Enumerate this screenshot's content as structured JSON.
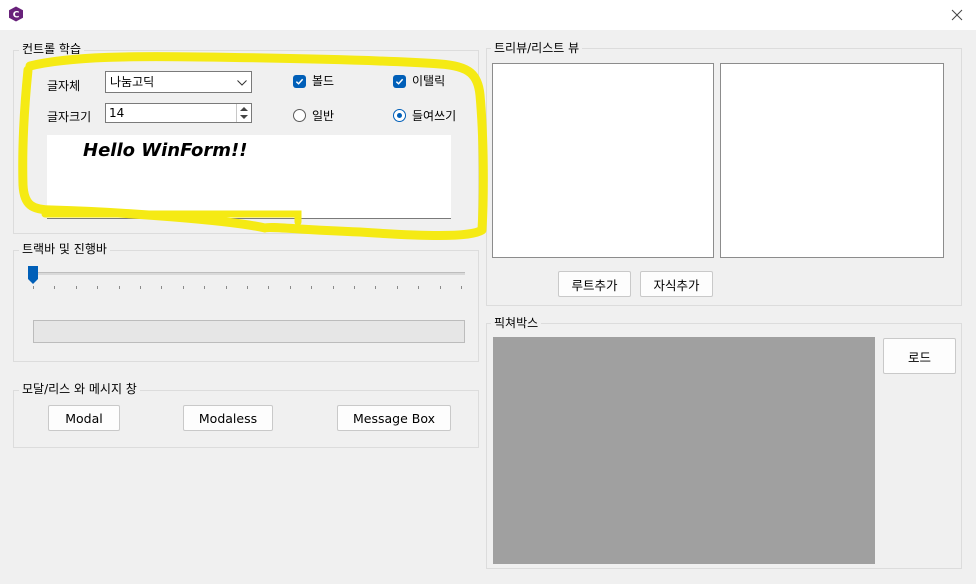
{
  "window": {
    "icon": "csharp-icon",
    "close_icon": "close-icon"
  },
  "controls_group": {
    "title": "컨트롤 학습",
    "font_label": "글자체",
    "font_value": "나눔고딕",
    "size_label": "글자크기",
    "size_value": "14",
    "bold_label": "볼드",
    "bold_checked": true,
    "italic_label": "이탤릭",
    "italic_checked": true,
    "normal_label": "일반",
    "indent_label": "들여쓰기",
    "selected_radio": "들여쓰기",
    "preview_text": "Hello WinForm!!"
  },
  "trackbar_group": {
    "title": "트랙바 및 진행바",
    "trackbar_value": 0,
    "progress_value": 0
  },
  "modal_group": {
    "title": "모달/리스 와 메시지 창",
    "modal_button": "Modal",
    "modaless_button": "Modaless",
    "messagebox_button": "Message Box"
  },
  "tree_group": {
    "title": "트리뷰/리스트 뷰",
    "add_root_button": "루트추가",
    "add_child_button": "자식추가"
  },
  "picture_group": {
    "title": "픽쳐박스",
    "load_button": "로드"
  },
  "annotation": {
    "color": "#f5ea14"
  }
}
